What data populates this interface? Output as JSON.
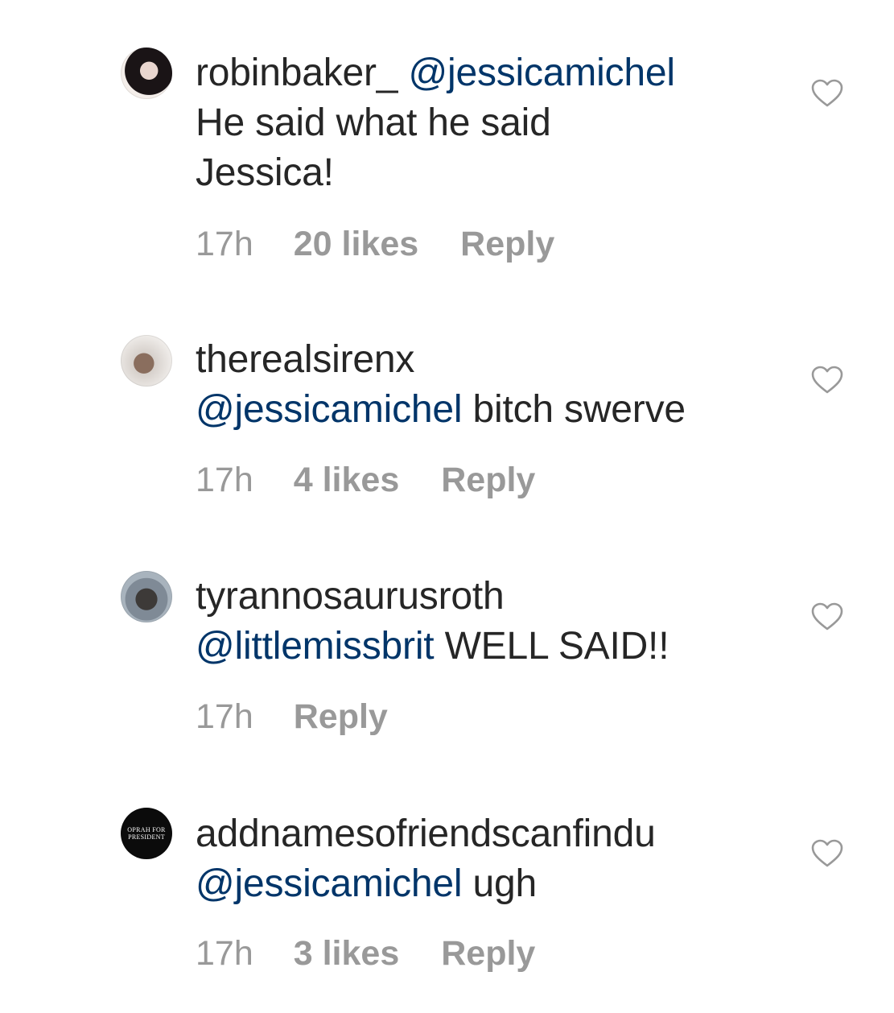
{
  "comments": [
    {
      "username": "robinbaker_",
      "mention": "@jessicamichel",
      "text_before": "",
      "text_after": "He said what he said Jessica!",
      "time": "17h",
      "likes": "20 likes",
      "reply": "Reply"
    },
    {
      "username": "therealsirenx",
      "mention": "@jessicamichel",
      "text_after": "bitch swerve",
      "time": "17h",
      "likes": "4 likes",
      "reply": "Reply"
    },
    {
      "username": "tyrannosaurusroth",
      "mention": "@littlemissbrit",
      "text_after": "WELL SAID!!",
      "time": "17h",
      "likes": "",
      "reply": "Reply"
    },
    {
      "username": "addnamesofriendscanfindu",
      "mention": "@jessicamichel",
      "text_after": "ugh",
      "time": "17h",
      "likes": "3 likes",
      "reply": "Reply",
      "avatar_text": "OPRAH FOR PRESIDENT"
    }
  ],
  "icons": {
    "like": "heart-outline-icon"
  },
  "colors": {
    "text": "#262626",
    "mention": "#003569",
    "meta": "#999999"
  }
}
